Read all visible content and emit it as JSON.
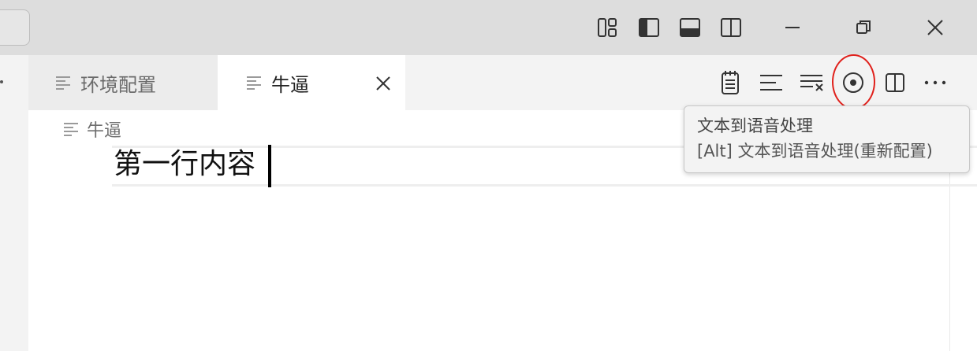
{
  "titlebar": {
    "icons": [
      "customize-layout-icon",
      "toggle-primary-sidebar-icon",
      "toggle-panel-icon",
      "toggle-secondary-sidebar-icon"
    ],
    "window_controls": [
      "minimize-icon",
      "restore-icon",
      "close-icon"
    ]
  },
  "tabs": [
    {
      "label": "环境配置",
      "active": false
    },
    {
      "label": "牛逼",
      "active": true
    }
  ],
  "editor_actions": [
    "notepad-icon",
    "align-text-icon",
    "clear-format-icon",
    "text-to-speech-icon",
    "split-editor-icon",
    "more-actions-icon"
  ],
  "breadcrumb": {
    "label": "牛逼"
  },
  "editor": {
    "line1": "第一行内容"
  },
  "tooltip": {
    "title": "文本到语音处理",
    "subtitle": "[Alt] 文本到语音处理(重新配置)"
  },
  "colors": {
    "highlight": "#e0201b",
    "titlebar": "#dddddd",
    "tabbar": "#f3f3f3"
  }
}
